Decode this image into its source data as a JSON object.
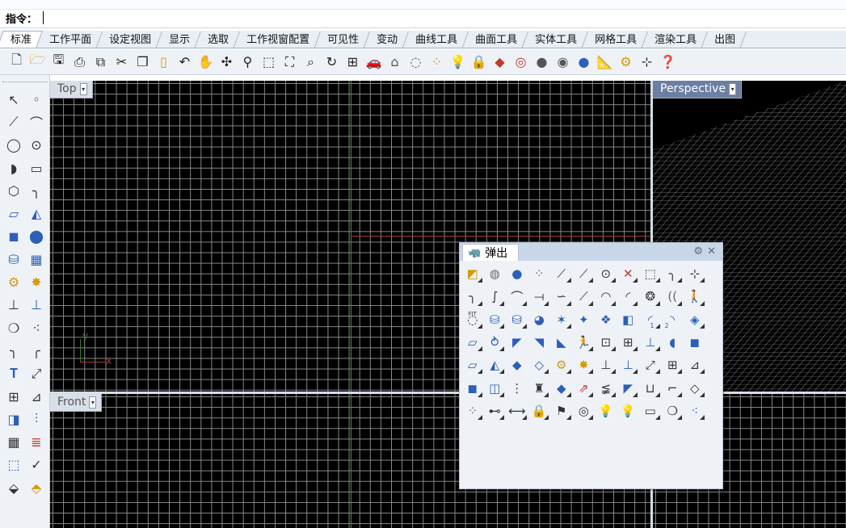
{
  "command": {
    "label": "指令：",
    "value": ""
  },
  "tabs": [
    "标准",
    "工作平面",
    "设定视图",
    "显示",
    "选取",
    "工作视窗配置",
    "可见性",
    "变动",
    "曲线工具",
    "曲面工具",
    "实体工具",
    "网格工具",
    "渲染工具",
    "出图"
  ],
  "toolbar_icons": [
    "new-file-icon",
    "open-file-icon",
    "save-icon",
    "print-icon",
    "import-icon",
    "cut-icon",
    "copy-icon",
    "paste-icon",
    "undo-icon",
    "pan-hand-icon",
    "rotate-view-icon",
    "zoom-icon",
    "zoom-window-icon",
    "zoom-extents-icon",
    "zoom-selected-icon",
    "rotate-camera-icon",
    "four-viewports-icon",
    "car-icon",
    "bracket-icon",
    "circle-dashed-icon",
    "select-points-icon",
    "light-bulb-icon",
    "lock-icon",
    "material-icon",
    "color-wheel-icon",
    "render-sphere-icon",
    "render-shaded-icon",
    "render-preview-icon",
    "measure-icon",
    "settings-gears-icon",
    "grid-snap-icon",
    "help-icon"
  ],
  "viewports": {
    "top": {
      "title": "Top"
    },
    "perspective": {
      "title": "Perspective"
    },
    "front": {
      "title": "Front"
    }
  },
  "axis_labels": {
    "y": "y",
    "x": "x"
  },
  "popup": {
    "title": "弹出"
  },
  "side_fit_label": "FIT",
  "side_nums": {
    "one": "1",
    "two": "2"
  }
}
